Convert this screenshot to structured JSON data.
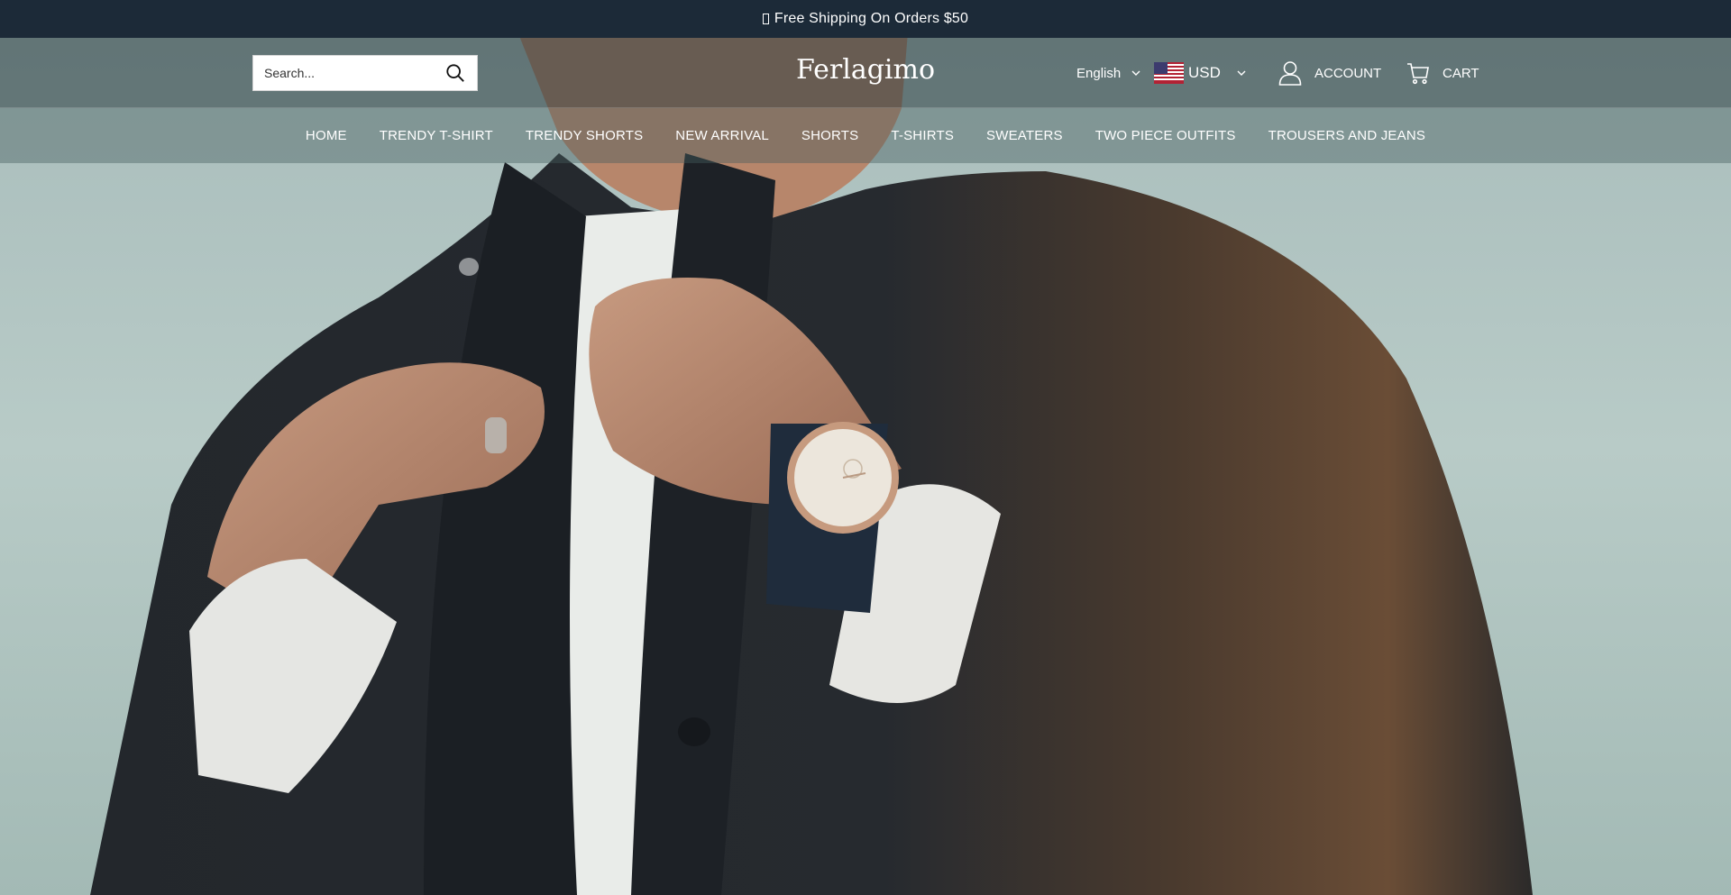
{
  "announcement": {
    "glyph": "box-glyph-icon",
    "text": "Free Shipping On Orders $50"
  },
  "header": {
    "search": {
      "placeholder": "Search..."
    },
    "logo": "Ferlagimo",
    "language": {
      "selected": "English"
    },
    "currency": {
      "selected": "USD",
      "flag": "us-flag-icon"
    },
    "account_label": "ACCOUNT",
    "cart_label": "CART"
  },
  "nav": {
    "items": [
      {
        "label": "HOME"
      },
      {
        "label": "TRENDY T-SHIRT"
      },
      {
        "label": "TRENDY SHORTS"
      },
      {
        "label": "NEW ARRIVAL"
      },
      {
        "label": "SHORTS"
      },
      {
        "label": "T-SHIRTS"
      },
      {
        "label": "SWEATERS"
      },
      {
        "label": "TWO PIECE OUTFITS"
      },
      {
        "label": "TROUSERS AND JEANS"
      }
    ]
  },
  "colors": {
    "announcement_bg": "#1c2a38",
    "text_on_dark": "#ffffff"
  }
}
